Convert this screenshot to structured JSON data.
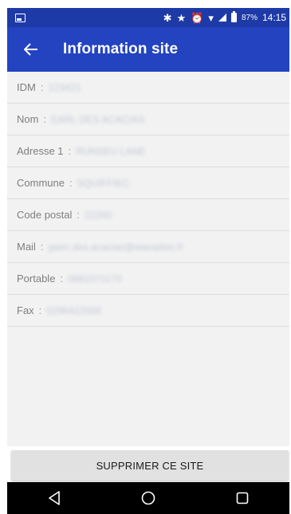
{
  "status_bar": {
    "battery_percent": "87%",
    "time": "14:15",
    "icons": [
      "image-icon",
      "bluetooth-icon",
      "star-icon",
      "alarm-icon",
      "wifi-icon",
      "signal-icon",
      "battery-icon"
    ]
  },
  "app_bar": {
    "back_icon": "arrow-left-icon",
    "title": "Information site"
  },
  "fields": [
    {
      "label": "IDM",
      "sep": ":",
      "value": "123421"
    },
    {
      "label": "Nom",
      "sep": ":",
      "value": "EARL DES ACACIAS"
    },
    {
      "label": "Adresse 1",
      "sep": ":",
      "value": "RUNSEU LANE"
    },
    {
      "label": "Commune",
      "sep": ":",
      "value": "SQUIFFIEC"
    },
    {
      "label": "Code postal",
      "sep": ":",
      "value": "22200"
    },
    {
      "label": "Mail",
      "sep": ":",
      "value": "gaec.des.acacias@wanadoo.fr"
    },
    {
      "label": "Portable",
      "sep": ":",
      "value": "0661071170"
    },
    {
      "label": "Fax",
      "sep": ":",
      "value": "0296422056"
    }
  ],
  "action_button": {
    "label": "SUPPRIMER CE SITE"
  },
  "nav_bar": {
    "icons": [
      "back-triangle-icon",
      "home-circle-icon",
      "recents-square-icon"
    ]
  },
  "colors": {
    "status_bar": "#1e3aa6",
    "app_bar": "#2343c0",
    "list_background": "#f2f2f2",
    "button_background": "#e1e1e1",
    "nav_bar": "#000000"
  }
}
